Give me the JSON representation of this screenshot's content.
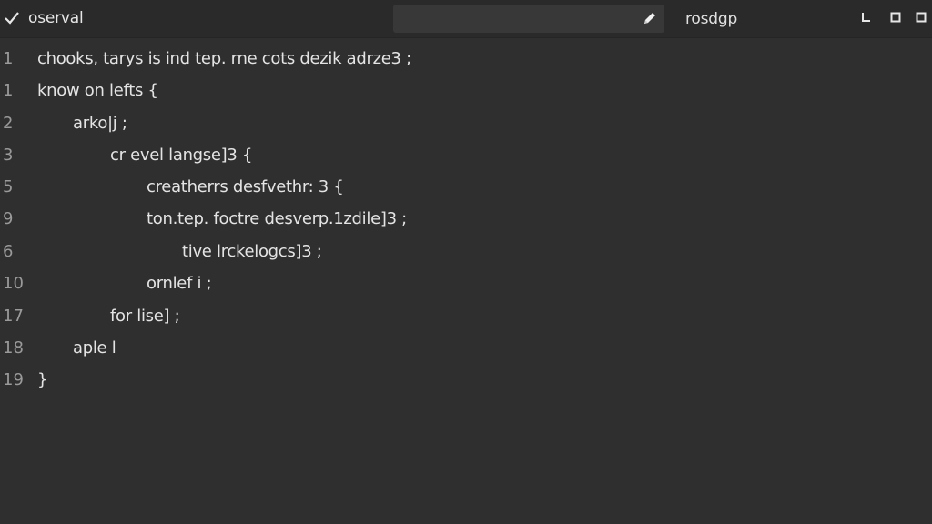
{
  "titlebar": {
    "title": "oserval",
    "search_value": "",
    "secondary_title": "rosdgp"
  },
  "editor": {
    "lines": [
      {
        "number": "1",
        "text": "chooks, tarys is ind tep. rne cots dezik adrze3 ;"
      },
      {
        "number": "1",
        "text": "know on lefts {"
      },
      {
        "number": "2",
        "text": "arko|j ;"
      },
      {
        "number": "3",
        "text": "cr evel langse]3 {"
      },
      {
        "number": "5",
        "text": "creatherrs desfvethr: 3 {"
      },
      {
        "number": "9",
        "text": "ton.tep. foctre desverp.1zdile]3 ;"
      },
      {
        "number": "6",
        "text": "tive lrckelogcs]3 ;"
      },
      {
        "number": "10",
        "text": "ornlef i ;"
      },
      {
        "number": "17",
        "text": "for lise] ;"
      },
      {
        "number": "18",
        "text": "aple l"
      },
      {
        "number": "19",
        "text": "}"
      }
    ]
  },
  "colors": {
    "background": "#2f2f2f",
    "titlebar": "#2a2a2a",
    "search_box": "#383838",
    "text": "#e4e4e4",
    "line_number": "#9a9a9a"
  },
  "icons": {
    "title_icon": "check-icon",
    "search_icon": "pencil-icon",
    "window_controls": [
      "minimize-icon",
      "maximize-icon",
      "close-icon"
    ]
  }
}
